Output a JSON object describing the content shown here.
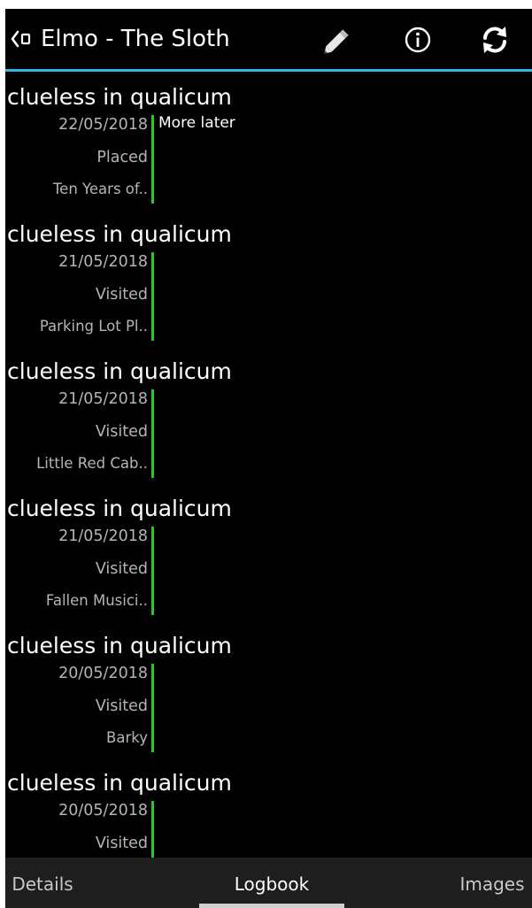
{
  "action_bar": {
    "title": "Elmo - The Sloth",
    "back_icon": "back-caret-icon",
    "actions": [
      {
        "icon": "pencil-icon",
        "name": "edit"
      },
      {
        "icon": "info-icon",
        "name": "info"
      },
      {
        "icon": "refresh-icon",
        "name": "refresh"
      }
    ],
    "accent_color": "#33b5e5"
  },
  "logs": [
    {
      "owner": "clueless in qualicum",
      "date": "22/05/2018",
      "type": "Placed",
      "cache": "Ten Years of..",
      "text": "More later"
    },
    {
      "owner": "clueless in qualicum",
      "date": "21/05/2018",
      "type": "Visited",
      "cache": "Parking Lot Pl..",
      "text": ""
    },
    {
      "owner": "clueless in qualicum",
      "date": "21/05/2018",
      "type": "Visited",
      "cache": "Little Red Cab..",
      "text": ""
    },
    {
      "owner": "clueless in qualicum",
      "date": "21/05/2018",
      "type": "Visited",
      "cache": "Fallen Musici..",
      "text": ""
    },
    {
      "owner": "clueless in qualicum",
      "date": "20/05/2018",
      "type": "Visited",
      "cache": "Barky",
      "text": ""
    },
    {
      "owner": "clueless in qualicum",
      "date": "20/05/2018",
      "type": "Visited",
      "cache": "",
      "text": ""
    }
  ],
  "log_bar_color": "#22cc22",
  "tabs": [
    {
      "label": "Details",
      "selected": false
    },
    {
      "label": "Logbook",
      "selected": true
    },
    {
      "label": "Images",
      "selected": false
    }
  ]
}
